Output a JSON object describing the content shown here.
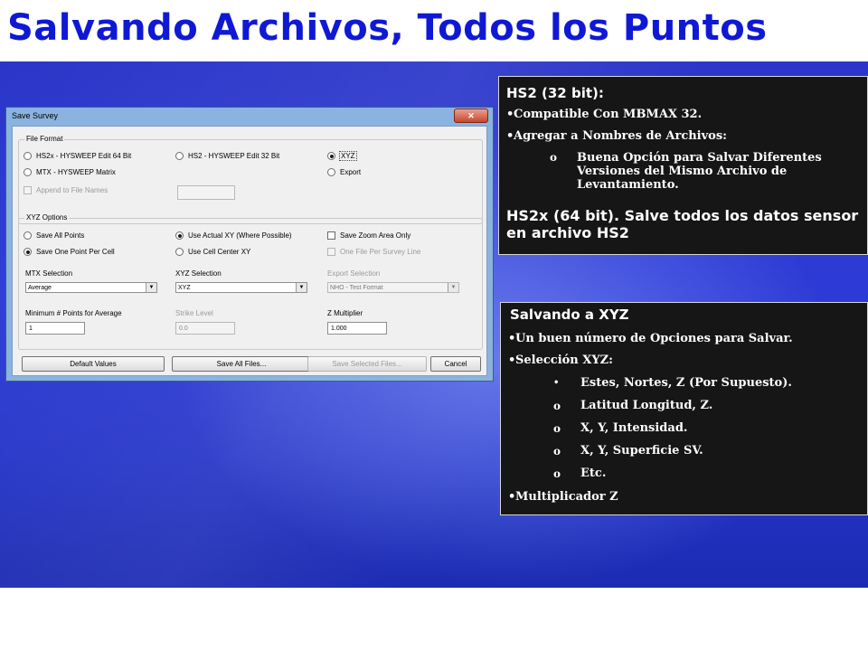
{
  "slide": {
    "title": "Salvando Archivos, Todos los Puntos"
  },
  "dialog": {
    "title": "Save Survey",
    "close_glyph": "✕",
    "file_format": {
      "group_label": "File Format",
      "hs2x": "HS2x - HYSWEEP Edit 64 Bit",
      "hs2": "HS2 - HYSWEEP Edit 32 Bit",
      "xyz": "XYZ",
      "mtx": "MTX - HYSWEEP Matrix",
      "export": "Export",
      "append": "Append to File Names"
    },
    "xyz_options": {
      "group_label": "XYZ Options",
      "save_all": "Save All Points",
      "save_one": "Save One Point Per Cell",
      "use_actual": "Use Actual XY (Where Possible)",
      "use_center": "Use Cell Center XY",
      "save_zoom": "Save Zoom Area Only",
      "one_file": "One File Per Survey Line",
      "mtx_label": "MTX Selection",
      "mtx_value": "Average",
      "xyz_label": "XYZ Selection",
      "xyz_value": "XYZ",
      "export_label": "Export Selection",
      "export_value": "NHO - Test Format",
      "min_label": "Minimum # Points for Average",
      "min_value": "1",
      "strike_label": "Strike Level",
      "strike_value": "0.0",
      "zmult_label": "Z Multiplier",
      "zmult_value": "1.000"
    },
    "buttons": {
      "default": "Default Values",
      "save_all": "Save All Files...",
      "save_selected": "Save Selected Files...",
      "cancel": "Cancel"
    }
  },
  "panel1": {
    "heading": "HS2 (32 bit):",
    "bullet_char": "•",
    "sub_bullet_char": "o",
    "item1": "Compatible Con MBMAX 32.",
    "item2": "Agregar a Nombres de Archivos:",
    "sub1": "Buena Opción para Salvar Diferentes Versiones del Mismo Archivo de Levantamiento.",
    "hs2x_note": "HS2x (64 bit).  Salve todos los datos sensor en archivo HS2"
  },
  "panel2": {
    "heading": "Salvando a XYZ",
    "bullet_char": "•",
    "sub_bullet_char": "o",
    "item1": "Un buen número de Opciones para Salvar.",
    "item2": "Selección XYZ:",
    "sub1": "Estes, Nortes, Z (Por Supuesto).",
    "sub2": "Latitud Longitud, Z.",
    "sub3": "X, Y, Intensidad.",
    "sub4": "X, Y, Superficie SV.",
    "sub5": "Etc.",
    "item3": "Multiplicador Z"
  }
}
